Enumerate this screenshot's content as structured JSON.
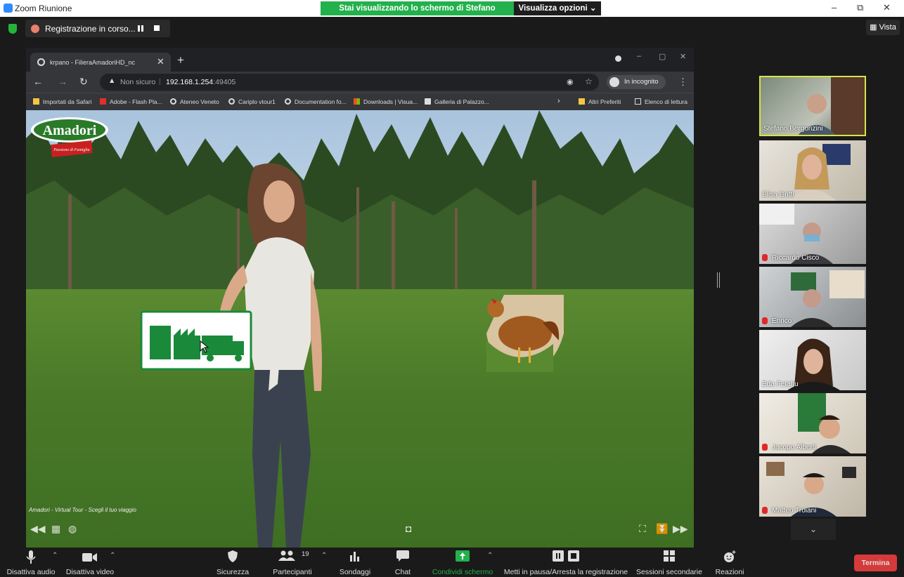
{
  "window": {
    "title": "Zoom Riunione",
    "minimize": "–",
    "restore": "⧉",
    "close": "✕"
  },
  "share_banner": {
    "text": "Stai visualizzando lo schermo di Stefano Bergonzini",
    "view_options": "Visualizza opzioni ⌄"
  },
  "recording": {
    "label": "Registrazione in corso..."
  },
  "vista": {
    "label": "Vista"
  },
  "browser": {
    "tab_title": "krpano - FilieraAmadoriHD_nc",
    "url_warning": "Non sicuro",
    "url_host": "192.168.1.254",
    "url_port": ":49405",
    "incognito": "In incognito",
    "bookmarks": [
      "Importati da Safari",
      "Adobe - Flash Pla...",
      "Ateneo Veneto",
      "Cariplo vtour1",
      "Documentation fo...",
      "Downloads | Visua...",
      "Galleria di Palazzo..."
    ],
    "other_favorites": "Altri Preferiti",
    "reading_list": "Elenco di lettura"
  },
  "tour": {
    "caption": "Amadori - Virtual Tour - Scegli il tuo viaggio",
    "logo_text": "Amadori",
    "logo_sub": "Passione di Famiglia"
  },
  "participants": [
    {
      "name": "Stefano Bergonzini",
      "muted": false,
      "active": true
    },
    {
      "name": "Elisa Gritti",
      "muted": false,
      "active": false
    },
    {
      "name": "Riccardo Cisco",
      "muted": true,
      "active": false
    },
    {
      "name": "Enrico",
      "muted": true,
      "active": false
    },
    {
      "name": "Eda Fetahu",
      "muted": false,
      "active": false
    },
    {
      "name": "Jacopo Alberti",
      "muted": true,
      "active": false
    },
    {
      "name": "Matteo Troiani",
      "muted": true,
      "active": false
    }
  ],
  "footer": {
    "audio": "Disattiva audio",
    "video": "Disattiva video",
    "security": "Sicurezza",
    "participants": "Partecipanti",
    "participants_count": "19",
    "polls": "Sondaggi",
    "chat": "Chat",
    "share": "Condividi schermo",
    "record": "Metti in pausa/Arresta la registrazione",
    "breakout": "Sessioni secondarie",
    "reactions": "Reazioni",
    "end": "Termina"
  },
  "colors": {
    "share_green": "#22b14c",
    "active_speaker": "#d9e34a",
    "end_red": "#d63a3a"
  }
}
